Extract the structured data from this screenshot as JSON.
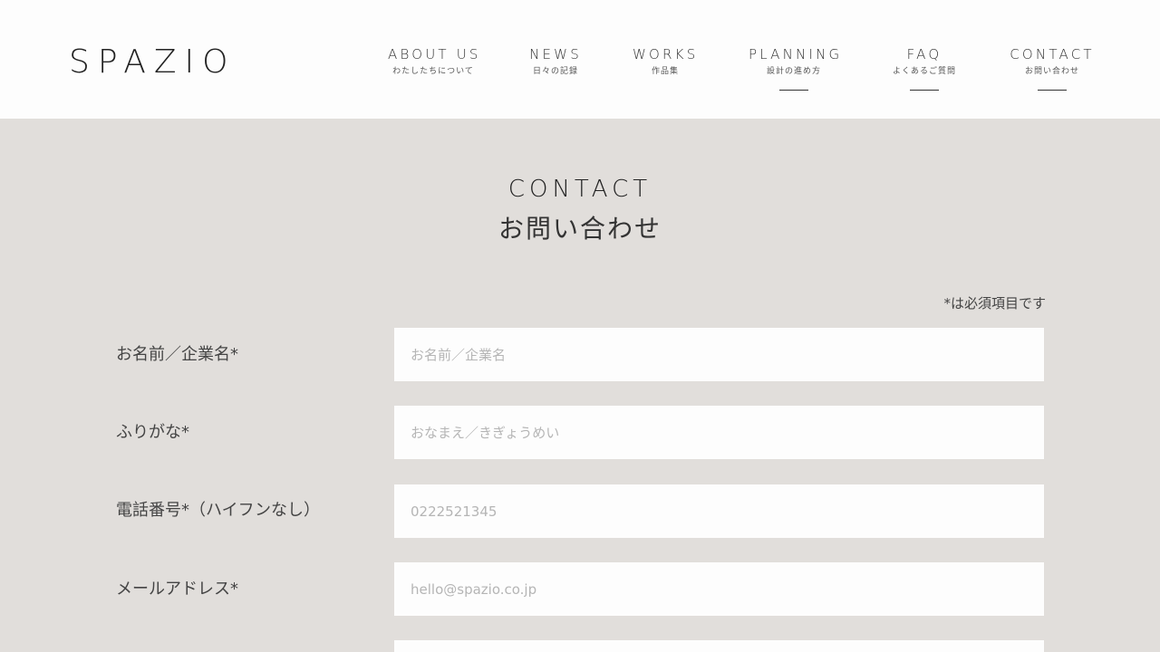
{
  "header": {
    "logo": "SPAZIO",
    "nav": [
      {
        "en": "ABOUT US",
        "jp": "わたしたちについて",
        "active": false
      },
      {
        "en": "NEWS",
        "jp": "日々の記録",
        "active": false
      },
      {
        "en": "WORKS",
        "jp": "作品集",
        "active": false
      },
      {
        "en": "PLANNING",
        "jp": "設計の進め方",
        "active": true
      },
      {
        "en": "FAQ",
        "jp": "よくあるご質問",
        "active": true
      },
      {
        "en": "CONTACT",
        "jp": "お問い合わせ",
        "active": true
      }
    ]
  },
  "page": {
    "title_en": "CONTACT",
    "title_jp": "お問い合わせ",
    "required_note": "*は必須項目です"
  },
  "form": {
    "fields": [
      {
        "label": "お名前／企業名*",
        "placeholder": "お名前／企業名",
        "value": ""
      },
      {
        "label": "ふりがな*",
        "placeholder": "おなまえ／きぎょうめい",
        "value": ""
      },
      {
        "label": "電話番号*（ハイフンなし）",
        "placeholder": "0222521345",
        "value": ""
      },
      {
        "label": "メールアドレス*",
        "placeholder": "hello@spazio.co.jp",
        "value": ""
      },
      {
        "label": "",
        "placeholder": "",
        "value": ""
      }
    ]
  },
  "colors": {
    "page_background": "#e1dedb",
    "header_background": "#fdfdfd",
    "input_background": "#fdfdfd",
    "text": "#333333",
    "placeholder": "#b5b5b5"
  }
}
